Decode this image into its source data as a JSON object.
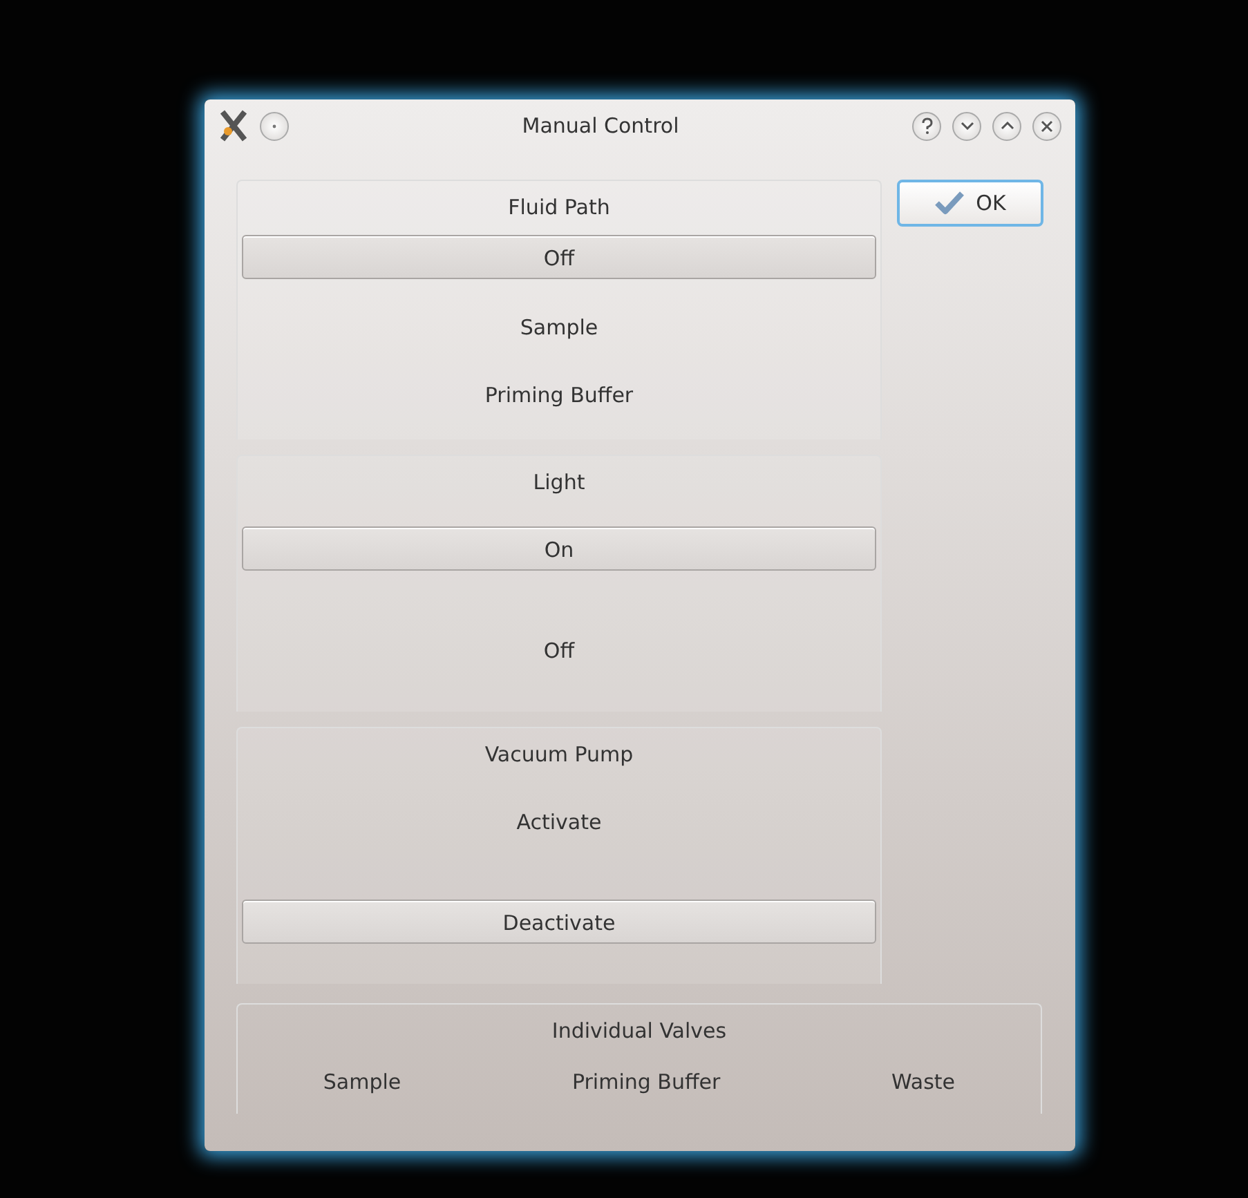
{
  "window": {
    "title": "Manual Control"
  },
  "groups": [
    {
      "title": "Fluid Path",
      "options": [
        {
          "label": "Off",
          "selected": true
        },
        {
          "label": "Sample",
          "selected": false
        },
        {
          "label": "Priming Buffer",
          "selected": false
        }
      ]
    },
    {
      "title": "Light",
      "options": [
        {
          "label": "On",
          "selected": true
        },
        {
          "label": "Off",
          "selected": false
        }
      ]
    },
    {
      "title": "Vacuum Pump",
      "options": [
        {
          "label": "Activate",
          "selected": false
        },
        {
          "label": "Deactivate",
          "selected": true
        }
      ]
    }
  ],
  "ok_button": {
    "label": "OK"
  },
  "valves": {
    "title": "Individual Valves",
    "items": [
      {
        "label": "Sample"
      },
      {
        "label": "Priming Buffer"
      },
      {
        "label": "Waste"
      }
    ]
  }
}
